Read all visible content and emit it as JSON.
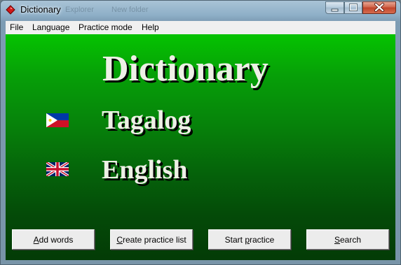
{
  "window": {
    "title": "Dictionary",
    "icon": "red-diamond-app-icon",
    "ghost_texts": [
      "Explorer",
      "New folder"
    ]
  },
  "menu": {
    "items": [
      "File",
      "Language",
      "Practice mode",
      "Help"
    ]
  },
  "main": {
    "title": "Dictionary",
    "languages": [
      {
        "name": "Tagalog",
        "flag": "philippines-flag-icon"
      },
      {
        "name": "English",
        "flag": "uk-flag-icon"
      }
    ]
  },
  "buttons": {
    "add_words": {
      "mnemonic": "A",
      "rest": "dd words"
    },
    "create_list": {
      "mnemonic": "C",
      "rest": "reate practice list"
    },
    "start_practice": {
      "before": "Start ",
      "mnemonic": "p",
      "rest": "ractice"
    },
    "search": {
      "mnemonic": "S",
      "rest": "earch"
    }
  },
  "colors": {
    "gradient_top": "#05c300",
    "gradient_bottom": "#033b06",
    "heading_text": "#eef0e6"
  }
}
